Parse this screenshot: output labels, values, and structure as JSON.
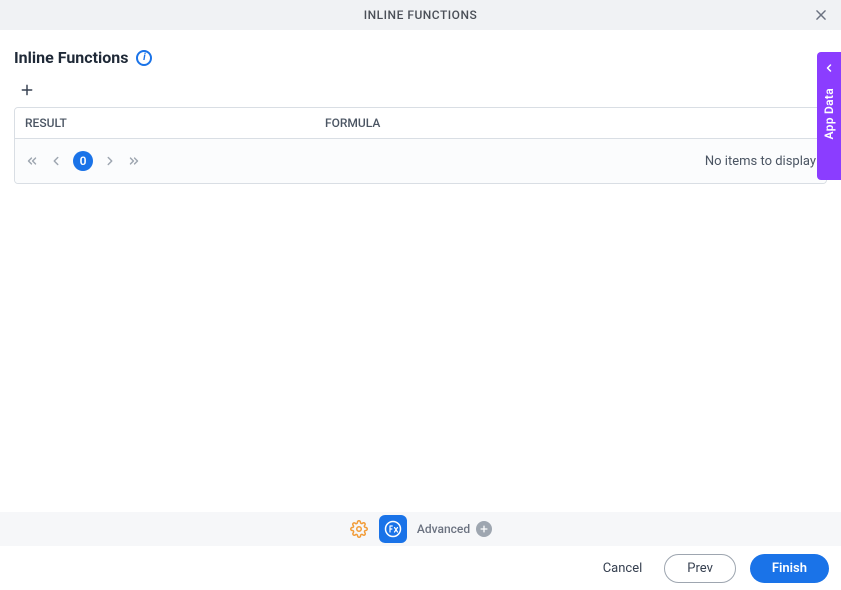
{
  "header": {
    "title": "INLINE FUNCTIONS"
  },
  "section": {
    "title": "Inline Functions"
  },
  "table": {
    "headers": {
      "result": "RESULT",
      "formula": "FORMULA"
    },
    "empty_message": "No items to display"
  },
  "pager": {
    "current_page": "0"
  },
  "side_tab": {
    "label": "App Data"
  },
  "toolbar": {
    "advanced_label": "Advanced"
  },
  "footer": {
    "cancel": "Cancel",
    "prev": "Prev",
    "finish": "Finish"
  }
}
